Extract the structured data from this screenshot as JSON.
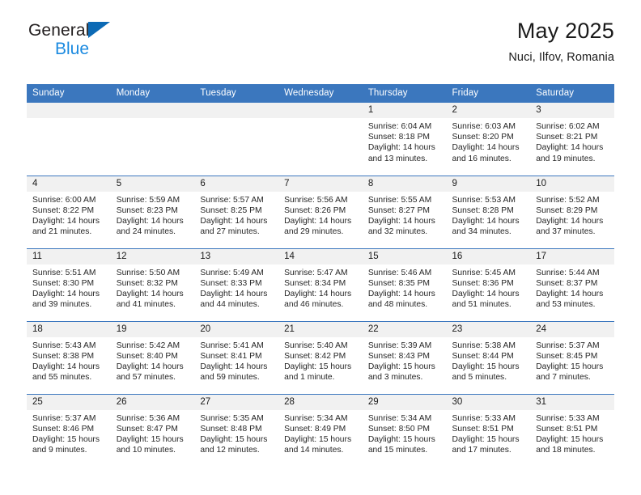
{
  "brand": {
    "name_part1": "General",
    "name_part2": "Blue",
    "logo_icon": "triangle-logo-icon",
    "colors": {
      "triangle": "#0c6ab5",
      "blue_text": "#1b8ae0",
      "dark_text": "#231f20"
    }
  },
  "header": {
    "title": "May 2025",
    "subtitle": "Nuci, Ilfov, Romania"
  },
  "theme": {
    "header_bg": "#3b77be",
    "header_text": "#ffffff",
    "daynum_bg": "#f1f1f1",
    "row_divider": "#3b77be"
  },
  "calendar": {
    "weekday_headers": [
      "Sunday",
      "Monday",
      "Tuesday",
      "Wednesday",
      "Thursday",
      "Friday",
      "Saturday"
    ],
    "weeks": [
      [
        {
          "day": "",
          "sunrise": "",
          "sunset": "",
          "daylight1": "",
          "daylight2": ""
        },
        {
          "day": "",
          "sunrise": "",
          "sunset": "",
          "daylight1": "",
          "daylight2": ""
        },
        {
          "day": "",
          "sunrise": "",
          "sunset": "",
          "daylight1": "",
          "daylight2": ""
        },
        {
          "day": "",
          "sunrise": "",
          "sunset": "",
          "daylight1": "",
          "daylight2": ""
        },
        {
          "day": "1",
          "sunrise": "Sunrise: 6:04 AM",
          "sunset": "Sunset: 8:18 PM",
          "daylight1": "Daylight: 14 hours",
          "daylight2": "and 13 minutes."
        },
        {
          "day": "2",
          "sunrise": "Sunrise: 6:03 AM",
          "sunset": "Sunset: 8:20 PM",
          "daylight1": "Daylight: 14 hours",
          "daylight2": "and 16 minutes."
        },
        {
          "day": "3",
          "sunrise": "Sunrise: 6:02 AM",
          "sunset": "Sunset: 8:21 PM",
          "daylight1": "Daylight: 14 hours",
          "daylight2": "and 19 minutes."
        }
      ],
      [
        {
          "day": "4",
          "sunrise": "Sunrise: 6:00 AM",
          "sunset": "Sunset: 8:22 PM",
          "daylight1": "Daylight: 14 hours",
          "daylight2": "and 21 minutes."
        },
        {
          "day": "5",
          "sunrise": "Sunrise: 5:59 AM",
          "sunset": "Sunset: 8:23 PM",
          "daylight1": "Daylight: 14 hours",
          "daylight2": "and 24 minutes."
        },
        {
          "day": "6",
          "sunrise": "Sunrise: 5:57 AM",
          "sunset": "Sunset: 8:25 PM",
          "daylight1": "Daylight: 14 hours",
          "daylight2": "and 27 minutes."
        },
        {
          "day": "7",
          "sunrise": "Sunrise: 5:56 AM",
          "sunset": "Sunset: 8:26 PM",
          "daylight1": "Daylight: 14 hours",
          "daylight2": "and 29 minutes."
        },
        {
          "day": "8",
          "sunrise": "Sunrise: 5:55 AM",
          "sunset": "Sunset: 8:27 PM",
          "daylight1": "Daylight: 14 hours",
          "daylight2": "and 32 minutes."
        },
        {
          "day": "9",
          "sunrise": "Sunrise: 5:53 AM",
          "sunset": "Sunset: 8:28 PM",
          "daylight1": "Daylight: 14 hours",
          "daylight2": "and 34 minutes."
        },
        {
          "day": "10",
          "sunrise": "Sunrise: 5:52 AM",
          "sunset": "Sunset: 8:29 PM",
          "daylight1": "Daylight: 14 hours",
          "daylight2": "and 37 minutes."
        }
      ],
      [
        {
          "day": "11",
          "sunrise": "Sunrise: 5:51 AM",
          "sunset": "Sunset: 8:30 PM",
          "daylight1": "Daylight: 14 hours",
          "daylight2": "and 39 minutes."
        },
        {
          "day": "12",
          "sunrise": "Sunrise: 5:50 AM",
          "sunset": "Sunset: 8:32 PM",
          "daylight1": "Daylight: 14 hours",
          "daylight2": "and 41 minutes."
        },
        {
          "day": "13",
          "sunrise": "Sunrise: 5:49 AM",
          "sunset": "Sunset: 8:33 PM",
          "daylight1": "Daylight: 14 hours",
          "daylight2": "and 44 minutes."
        },
        {
          "day": "14",
          "sunrise": "Sunrise: 5:47 AM",
          "sunset": "Sunset: 8:34 PM",
          "daylight1": "Daylight: 14 hours",
          "daylight2": "and 46 minutes."
        },
        {
          "day": "15",
          "sunrise": "Sunrise: 5:46 AM",
          "sunset": "Sunset: 8:35 PM",
          "daylight1": "Daylight: 14 hours",
          "daylight2": "and 48 minutes."
        },
        {
          "day": "16",
          "sunrise": "Sunrise: 5:45 AM",
          "sunset": "Sunset: 8:36 PM",
          "daylight1": "Daylight: 14 hours",
          "daylight2": "and 51 minutes."
        },
        {
          "day": "17",
          "sunrise": "Sunrise: 5:44 AM",
          "sunset": "Sunset: 8:37 PM",
          "daylight1": "Daylight: 14 hours",
          "daylight2": "and 53 minutes."
        }
      ],
      [
        {
          "day": "18",
          "sunrise": "Sunrise: 5:43 AM",
          "sunset": "Sunset: 8:38 PM",
          "daylight1": "Daylight: 14 hours",
          "daylight2": "and 55 minutes."
        },
        {
          "day": "19",
          "sunrise": "Sunrise: 5:42 AM",
          "sunset": "Sunset: 8:40 PM",
          "daylight1": "Daylight: 14 hours",
          "daylight2": "and 57 minutes."
        },
        {
          "day": "20",
          "sunrise": "Sunrise: 5:41 AM",
          "sunset": "Sunset: 8:41 PM",
          "daylight1": "Daylight: 14 hours",
          "daylight2": "and 59 minutes."
        },
        {
          "day": "21",
          "sunrise": "Sunrise: 5:40 AM",
          "sunset": "Sunset: 8:42 PM",
          "daylight1": "Daylight: 15 hours",
          "daylight2": "and 1 minute."
        },
        {
          "day": "22",
          "sunrise": "Sunrise: 5:39 AM",
          "sunset": "Sunset: 8:43 PM",
          "daylight1": "Daylight: 15 hours",
          "daylight2": "and 3 minutes."
        },
        {
          "day": "23",
          "sunrise": "Sunrise: 5:38 AM",
          "sunset": "Sunset: 8:44 PM",
          "daylight1": "Daylight: 15 hours",
          "daylight2": "and 5 minutes."
        },
        {
          "day": "24",
          "sunrise": "Sunrise: 5:37 AM",
          "sunset": "Sunset: 8:45 PM",
          "daylight1": "Daylight: 15 hours",
          "daylight2": "and 7 minutes."
        }
      ],
      [
        {
          "day": "25",
          "sunrise": "Sunrise: 5:37 AM",
          "sunset": "Sunset: 8:46 PM",
          "daylight1": "Daylight: 15 hours",
          "daylight2": "and 9 minutes."
        },
        {
          "day": "26",
          "sunrise": "Sunrise: 5:36 AM",
          "sunset": "Sunset: 8:47 PM",
          "daylight1": "Daylight: 15 hours",
          "daylight2": "and 10 minutes."
        },
        {
          "day": "27",
          "sunrise": "Sunrise: 5:35 AM",
          "sunset": "Sunset: 8:48 PM",
          "daylight1": "Daylight: 15 hours",
          "daylight2": "and 12 minutes."
        },
        {
          "day": "28",
          "sunrise": "Sunrise: 5:34 AM",
          "sunset": "Sunset: 8:49 PM",
          "daylight1": "Daylight: 15 hours",
          "daylight2": "and 14 minutes."
        },
        {
          "day": "29",
          "sunrise": "Sunrise: 5:34 AM",
          "sunset": "Sunset: 8:50 PM",
          "daylight1": "Daylight: 15 hours",
          "daylight2": "and 15 minutes."
        },
        {
          "day": "30",
          "sunrise": "Sunrise: 5:33 AM",
          "sunset": "Sunset: 8:51 PM",
          "daylight1": "Daylight: 15 hours",
          "daylight2": "and 17 minutes."
        },
        {
          "day": "31",
          "sunrise": "Sunrise: 5:33 AM",
          "sunset": "Sunset: 8:51 PM",
          "daylight1": "Daylight: 15 hours",
          "daylight2": "and 18 minutes."
        }
      ]
    ]
  }
}
